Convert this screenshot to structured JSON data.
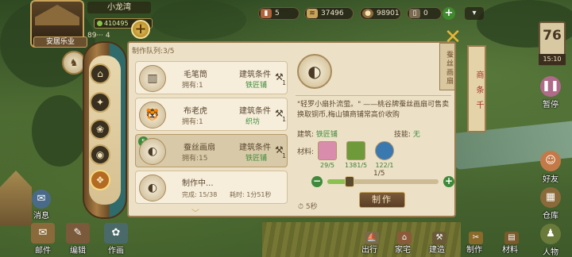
{
  "player": {
    "name": "小龙湾",
    "exp": "410495",
    "title": "安居乐业",
    "population": "89··· 4"
  },
  "resources": {
    "brick": "5",
    "coin": "37496",
    "copper": "98901",
    "ticket": "0"
  },
  "calendar": {
    "day": "76",
    "time": "15:10"
  },
  "banner": "商 条 千",
  "side_buttons": {
    "pause": "暂停",
    "friends": "好友",
    "warehouse": "仓库",
    "people": "人物"
  },
  "bottom_left": {
    "message": "消息",
    "mail": "邮件",
    "edit": "编辑",
    "work": "作画"
  },
  "bottom_nav": [
    "出行",
    "家宅",
    "建造",
    "制作",
    "材料"
  ],
  "panel": {
    "queue": "制作队列:3/5",
    "tag": "蚕丝画扇",
    "items": [
      {
        "name": "毛笔筒",
        "owned": "拥有:1",
        "cond": "建筑条件",
        "building": "铁匠铺",
        "hammer": "1"
      },
      {
        "name": "布老虎",
        "owned": "拥有:1",
        "cond": "建筑条件",
        "building": "织坊",
        "hammer": "1"
      },
      {
        "name": "蚕丝画扇",
        "owned": "拥有:15",
        "cond": "建筑条件",
        "building": "铁匠铺",
        "hammer": "1",
        "badge": "5"
      }
    ],
    "in_progress": {
      "name": "制作中...",
      "done": "完成: 15/38",
      "time_left": "耗时: 1分51秒"
    },
    "detail": {
      "desc": "\"轻罗小扇扑流萤。\" ——桃谷牌蚕丝画扇可售卖换取铜币,梅山镇商铺常高价收购",
      "building_label": "建筑:",
      "building": "铁匠铺",
      "skill_label": "技能:",
      "skill": "无",
      "materials_label": "材料:",
      "materials": [
        {
          "name": "fabric",
          "count": "29/5"
        },
        {
          "name": "bamboo",
          "count": "1381/5"
        },
        {
          "name": "dye",
          "count": "122/1"
        }
      ],
      "quantity": "1/5",
      "quantity_fraction": 0.2,
      "make": "制作",
      "duration": "5秒"
    }
  },
  "colors": {
    "accent": "#c9a35a",
    "green": "#3f8a3a",
    "panel": "#ece1c7"
  },
  "icons": [
    "brick-icon",
    "coin-icon",
    "copper-icon",
    "ticket-icon",
    "fan-icon",
    "hammer-icon",
    "close-icon"
  ]
}
